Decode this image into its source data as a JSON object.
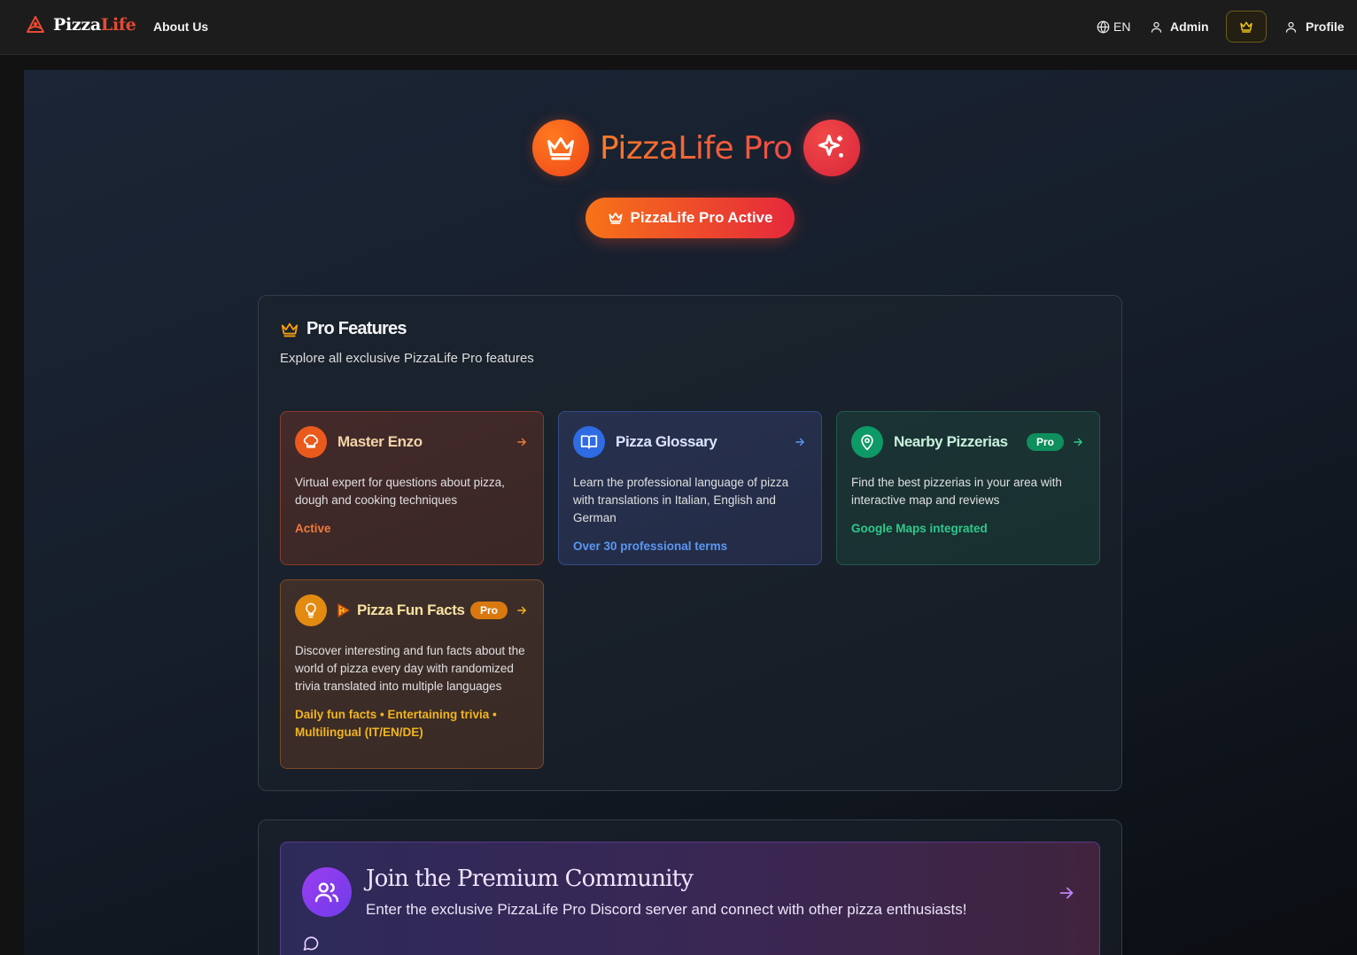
{
  "navbar": {
    "brand_part1": "Pizza",
    "brand_part2": "Life",
    "about": "About Us",
    "language": "EN",
    "admin": "Admin",
    "profile": "Profile"
  },
  "hero": {
    "title": "PizzaLife Pro",
    "status_button": "PizzaLife Pro Active"
  },
  "features": {
    "title": "Pro Features",
    "subtitle": "Explore all exclusive PizzaLife Pro features",
    "cards": [
      {
        "title": "Master Enzo",
        "description": "Virtual expert for questions about pizza, dough and cooking techniques",
        "note": "Active",
        "icon": "chef-hat-icon"
      },
      {
        "title": "Pizza Glossary",
        "description": "Learn the professional language of pizza with translations in Italian, English and German",
        "note": "Over 30 professional terms",
        "icon": "book-open-icon"
      },
      {
        "title": "Nearby Pizzerias",
        "badge": "Pro",
        "description": "Find the best pizzerias in your area with interactive map and reviews",
        "note": "Google Maps integrated",
        "icon": "map-pin-icon"
      },
      {
        "title": "Pizza Fun Facts",
        "badge": "Pro",
        "description": "Discover interesting and fun facts about the world of pizza every day with randomized trivia translated into multiple languages",
        "note": "Daily fun facts • Entertaining trivia • Multilingual (IT/EN/DE)",
        "icon": "lightbulb-icon"
      }
    ]
  },
  "community": {
    "title": "Join the Premium Community",
    "subtitle": "Enter the exclusive PizzaLife Pro Discord server and connect with other pizza enthusiasts!"
  },
  "colors": {
    "accent_orange": "#f77318",
    "accent_red": "#e5283c",
    "glossary_blue": "#2f6be3",
    "nearby_green": "#0e9a66",
    "funfacts_amber": "#e38a11",
    "community_purple": "#7c3aed"
  }
}
